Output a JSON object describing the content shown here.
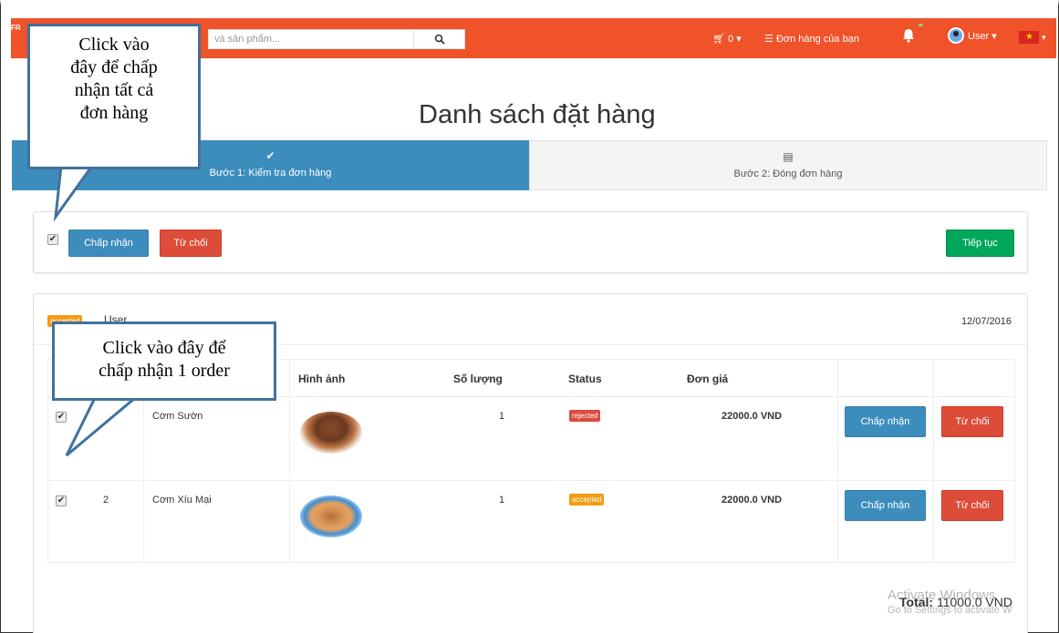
{
  "navbar": {
    "brand": "FR",
    "search_placeholder": "và sản phẩm...",
    "search_icon": "search-icon",
    "cart_label": "0 ▾",
    "orders_label": "Đơn hàng của bạn",
    "user_label": "User ▾",
    "lang_caret": "▾",
    "accent_color": "#f0522a"
  },
  "page": {
    "title": "Danh sách đặt hàng"
  },
  "steps": [
    {
      "icon": "check-icon",
      "glyph": "✔",
      "label": "Bước 1: Kiểm tra đơn hàng"
    },
    {
      "icon": "list-icon",
      "glyph": "▤",
      "label": "Bước 2: Đóng đơn hàng"
    }
  ],
  "actions": {
    "accept_all": "Chấp nhận",
    "reject_all": "Từ chối",
    "continue": "Tiếp tục"
  },
  "order": {
    "status_badge": "accepted",
    "user": "User",
    "date": "12/07/2016",
    "columns": [
      "Hình ảnh",
      "Số lượng",
      "Status",
      "Đơn giá"
    ],
    "items": [
      {
        "index": "",
        "name": "Cơm Sườn",
        "qty": "1",
        "status": "rejected",
        "price": "22000.0 VND",
        "accept": "Chấp nhận",
        "reject": "Từ chối"
      },
      {
        "index": "2",
        "name": "Cơm Xíu Mại",
        "qty": "1",
        "status": "accepted",
        "price": "22000.0 VND",
        "accept": "Chấp nhận",
        "reject": "Từ chối"
      }
    ],
    "total_label": "Total:",
    "total_value": "11000.0 VND"
  },
  "watermark": {
    "line1": "Activate Windows",
    "line2": "Go to Settings to activate W"
  },
  "callouts": {
    "accept_all_line1": "Click vào",
    "accept_all_line2": "đây để chấp",
    "accept_all_line3": "nhận tất cả",
    "accept_all_line4": "đơn hàng",
    "accept_one_line1": "Click vào đây để",
    "accept_one_line2": "chấp nhận 1 order"
  }
}
